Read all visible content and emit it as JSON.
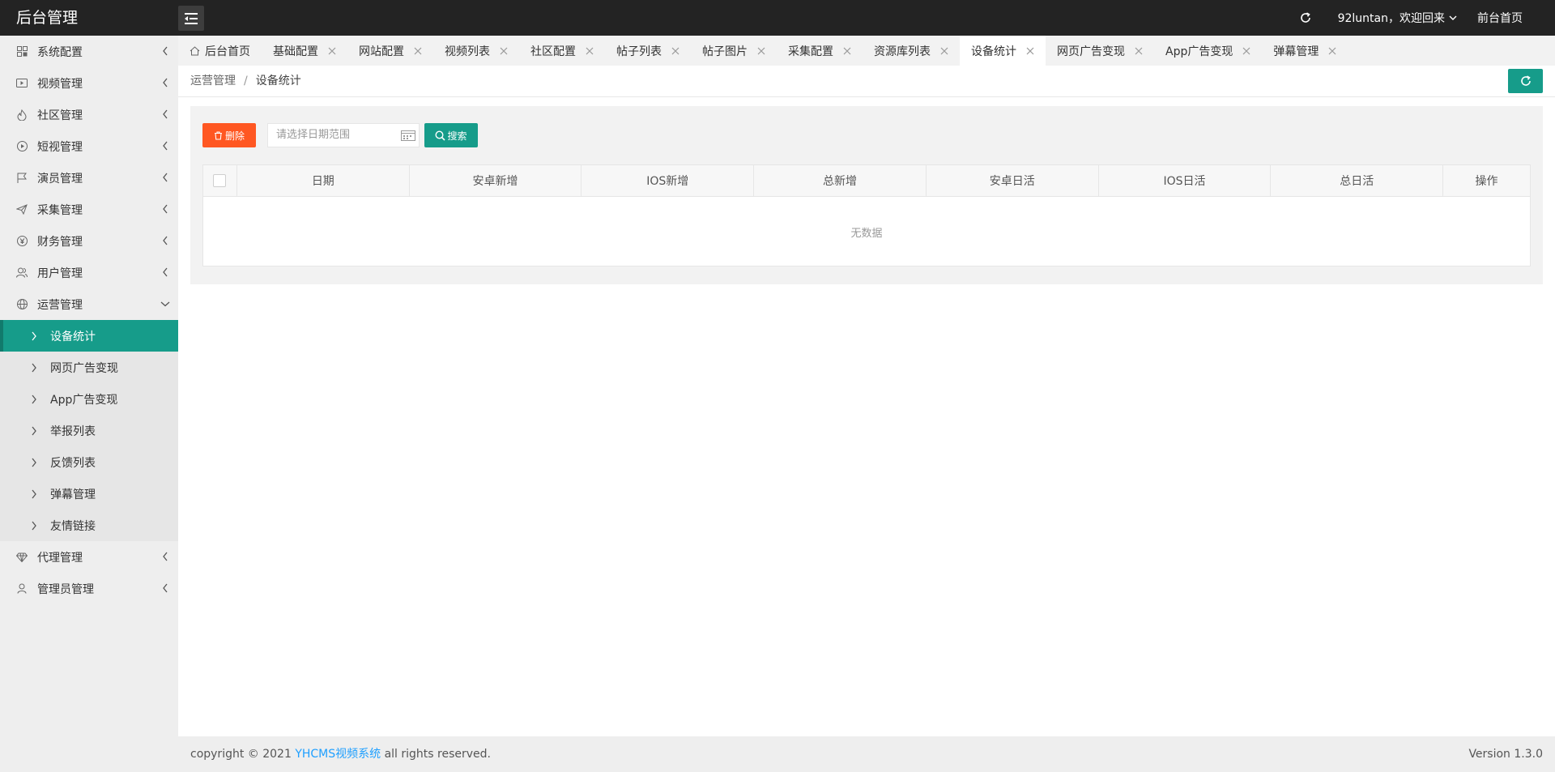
{
  "header": {
    "logo": "后台管理",
    "user_greeting": "92luntan，欢迎回来",
    "front_link": "前台首页"
  },
  "sidebar": {
    "items": [
      {
        "label": "系统配置",
        "icon": "config-icon"
      },
      {
        "label": "视频管理",
        "icon": "video-icon"
      },
      {
        "label": "社区管理",
        "icon": "fire-icon"
      },
      {
        "label": "短视管理",
        "icon": "play-icon"
      },
      {
        "label": "演员管理",
        "icon": "flag-icon"
      },
      {
        "label": "采集管理",
        "icon": "send-icon"
      },
      {
        "label": "财务管理",
        "icon": "yen-icon"
      },
      {
        "label": "用户管理",
        "icon": "users-icon"
      },
      {
        "label": "运营管理",
        "icon": "globe-icon"
      }
    ],
    "operations_children": [
      "设备统计",
      "网页广告变现",
      "App广告变现",
      "举报列表",
      "反馈列表",
      "弹幕管理",
      "友情链接"
    ],
    "bottom_items": [
      {
        "label": "代理管理",
        "icon": "diamond-icon"
      },
      {
        "label": "管理员管理",
        "icon": "user-icon"
      }
    ]
  },
  "tabs": [
    "后台首页",
    "基础配置",
    "网站配置",
    "视频列表",
    "社区配置",
    "帖子列表",
    "帖子图片",
    "采集配置",
    "资源库列表",
    "设备统计",
    "网页广告变现",
    "App广告变现",
    "弹幕管理"
  ],
  "breadcrumb": {
    "parent": "运营管理",
    "separator": "/",
    "current": "设备统计"
  },
  "toolbar": {
    "delete_label": "删除",
    "date_placeholder": "请选择日期范围",
    "search_label": "搜索"
  },
  "table": {
    "columns": [
      "日期",
      "安卓新增",
      "IOS新增",
      "总新增",
      "安卓日活",
      "IOS日活",
      "总日活",
      "操作"
    ],
    "empty_text": "无数据"
  },
  "footer": {
    "copyright_prefix": "copyright © 2021 ",
    "brand": "YHCMS视频系统",
    "copyright_suffix": " all rights reserved.",
    "version": "Version 1.3.0"
  },
  "colors": {
    "header_bg": "#232323",
    "sidebar_bg": "#eeeeee",
    "accent": "#169c8a",
    "danger": "#ff5722",
    "link": "#1e9fff"
  }
}
